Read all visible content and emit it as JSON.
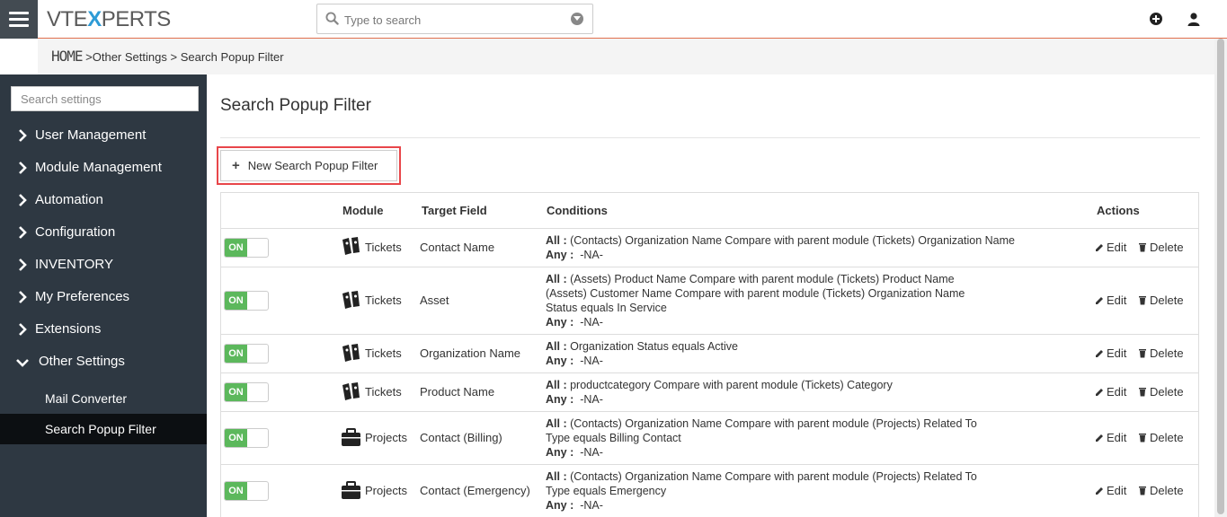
{
  "app": {
    "logo_left": "VTE",
    "logo_x": "X",
    "logo_right": "PERTS"
  },
  "topbar": {
    "search_placeholder": "Type to search"
  },
  "breadcrumb": {
    "home": "HOME",
    "sep1": ">",
    "item1": "Other Settings",
    "sep2": ">",
    "item2": "Search Popup Filter"
  },
  "sidebar": {
    "search_placeholder": "Search settings",
    "items": [
      {
        "label": "User Management"
      },
      {
        "label": "Module Management"
      },
      {
        "label": "Automation"
      },
      {
        "label": "Configuration"
      },
      {
        "label": "INVENTORY"
      },
      {
        "label": "My Preferences"
      },
      {
        "label": "Extensions"
      },
      {
        "label": "Other Settings"
      }
    ],
    "subitems": [
      {
        "label": "Mail Converter"
      },
      {
        "label": "Search Popup Filter"
      }
    ]
  },
  "main": {
    "title": "Search Popup Filter",
    "new_button": "New Search Popup Filter",
    "columns": {
      "module": "Module",
      "target": "Target Field",
      "conditions": "Conditions",
      "actions": "Actions"
    },
    "toggle_label": "ON",
    "edit_label": "Edit",
    "delete_label": "Delete",
    "all_label": "All :",
    "any_label": "Any :",
    "rows": [
      {
        "module": "Tickets",
        "target": "Contact Name",
        "all": [
          "(Contacts) Organization Name Compare with parent module (Tickets) Organization Name"
        ],
        "any": "-NA-"
      },
      {
        "module": "Tickets",
        "target": "Asset",
        "all": [
          "(Assets) Product Name Compare with parent module (Tickets) Product Name",
          "(Assets) Customer Name Compare with parent module (Tickets) Organization Name",
          "Status equals In Service"
        ],
        "any": "-NA-"
      },
      {
        "module": "Tickets",
        "target": "Organization Name",
        "all": [
          "Organization Status equals Active"
        ],
        "any": "-NA-"
      },
      {
        "module": "Tickets",
        "target": "Product Name",
        "all": [
          "productcategory Compare with parent module (Tickets) Category"
        ],
        "any": "-NA-"
      },
      {
        "module": "Projects",
        "target": "Contact (Billing)",
        "all": [
          "(Contacts) Organization Name Compare with parent module (Projects) Related To",
          "Type equals Billing Contact"
        ],
        "any": "-NA-"
      },
      {
        "module": "Projects",
        "target": "Contact (Emergency)",
        "all": [
          "(Contacts) Organization Name Compare with parent module (Projects) Related To",
          "Type equals Emergency"
        ],
        "any": "-NA-"
      }
    ]
  },
  "colors": {
    "sidebar_bg": "#2e3842",
    "active_bg": "#0c0f12",
    "toggle_on": "#5cb85c",
    "accent_line": "#e0704e",
    "highlight_box": "#e8464a"
  }
}
